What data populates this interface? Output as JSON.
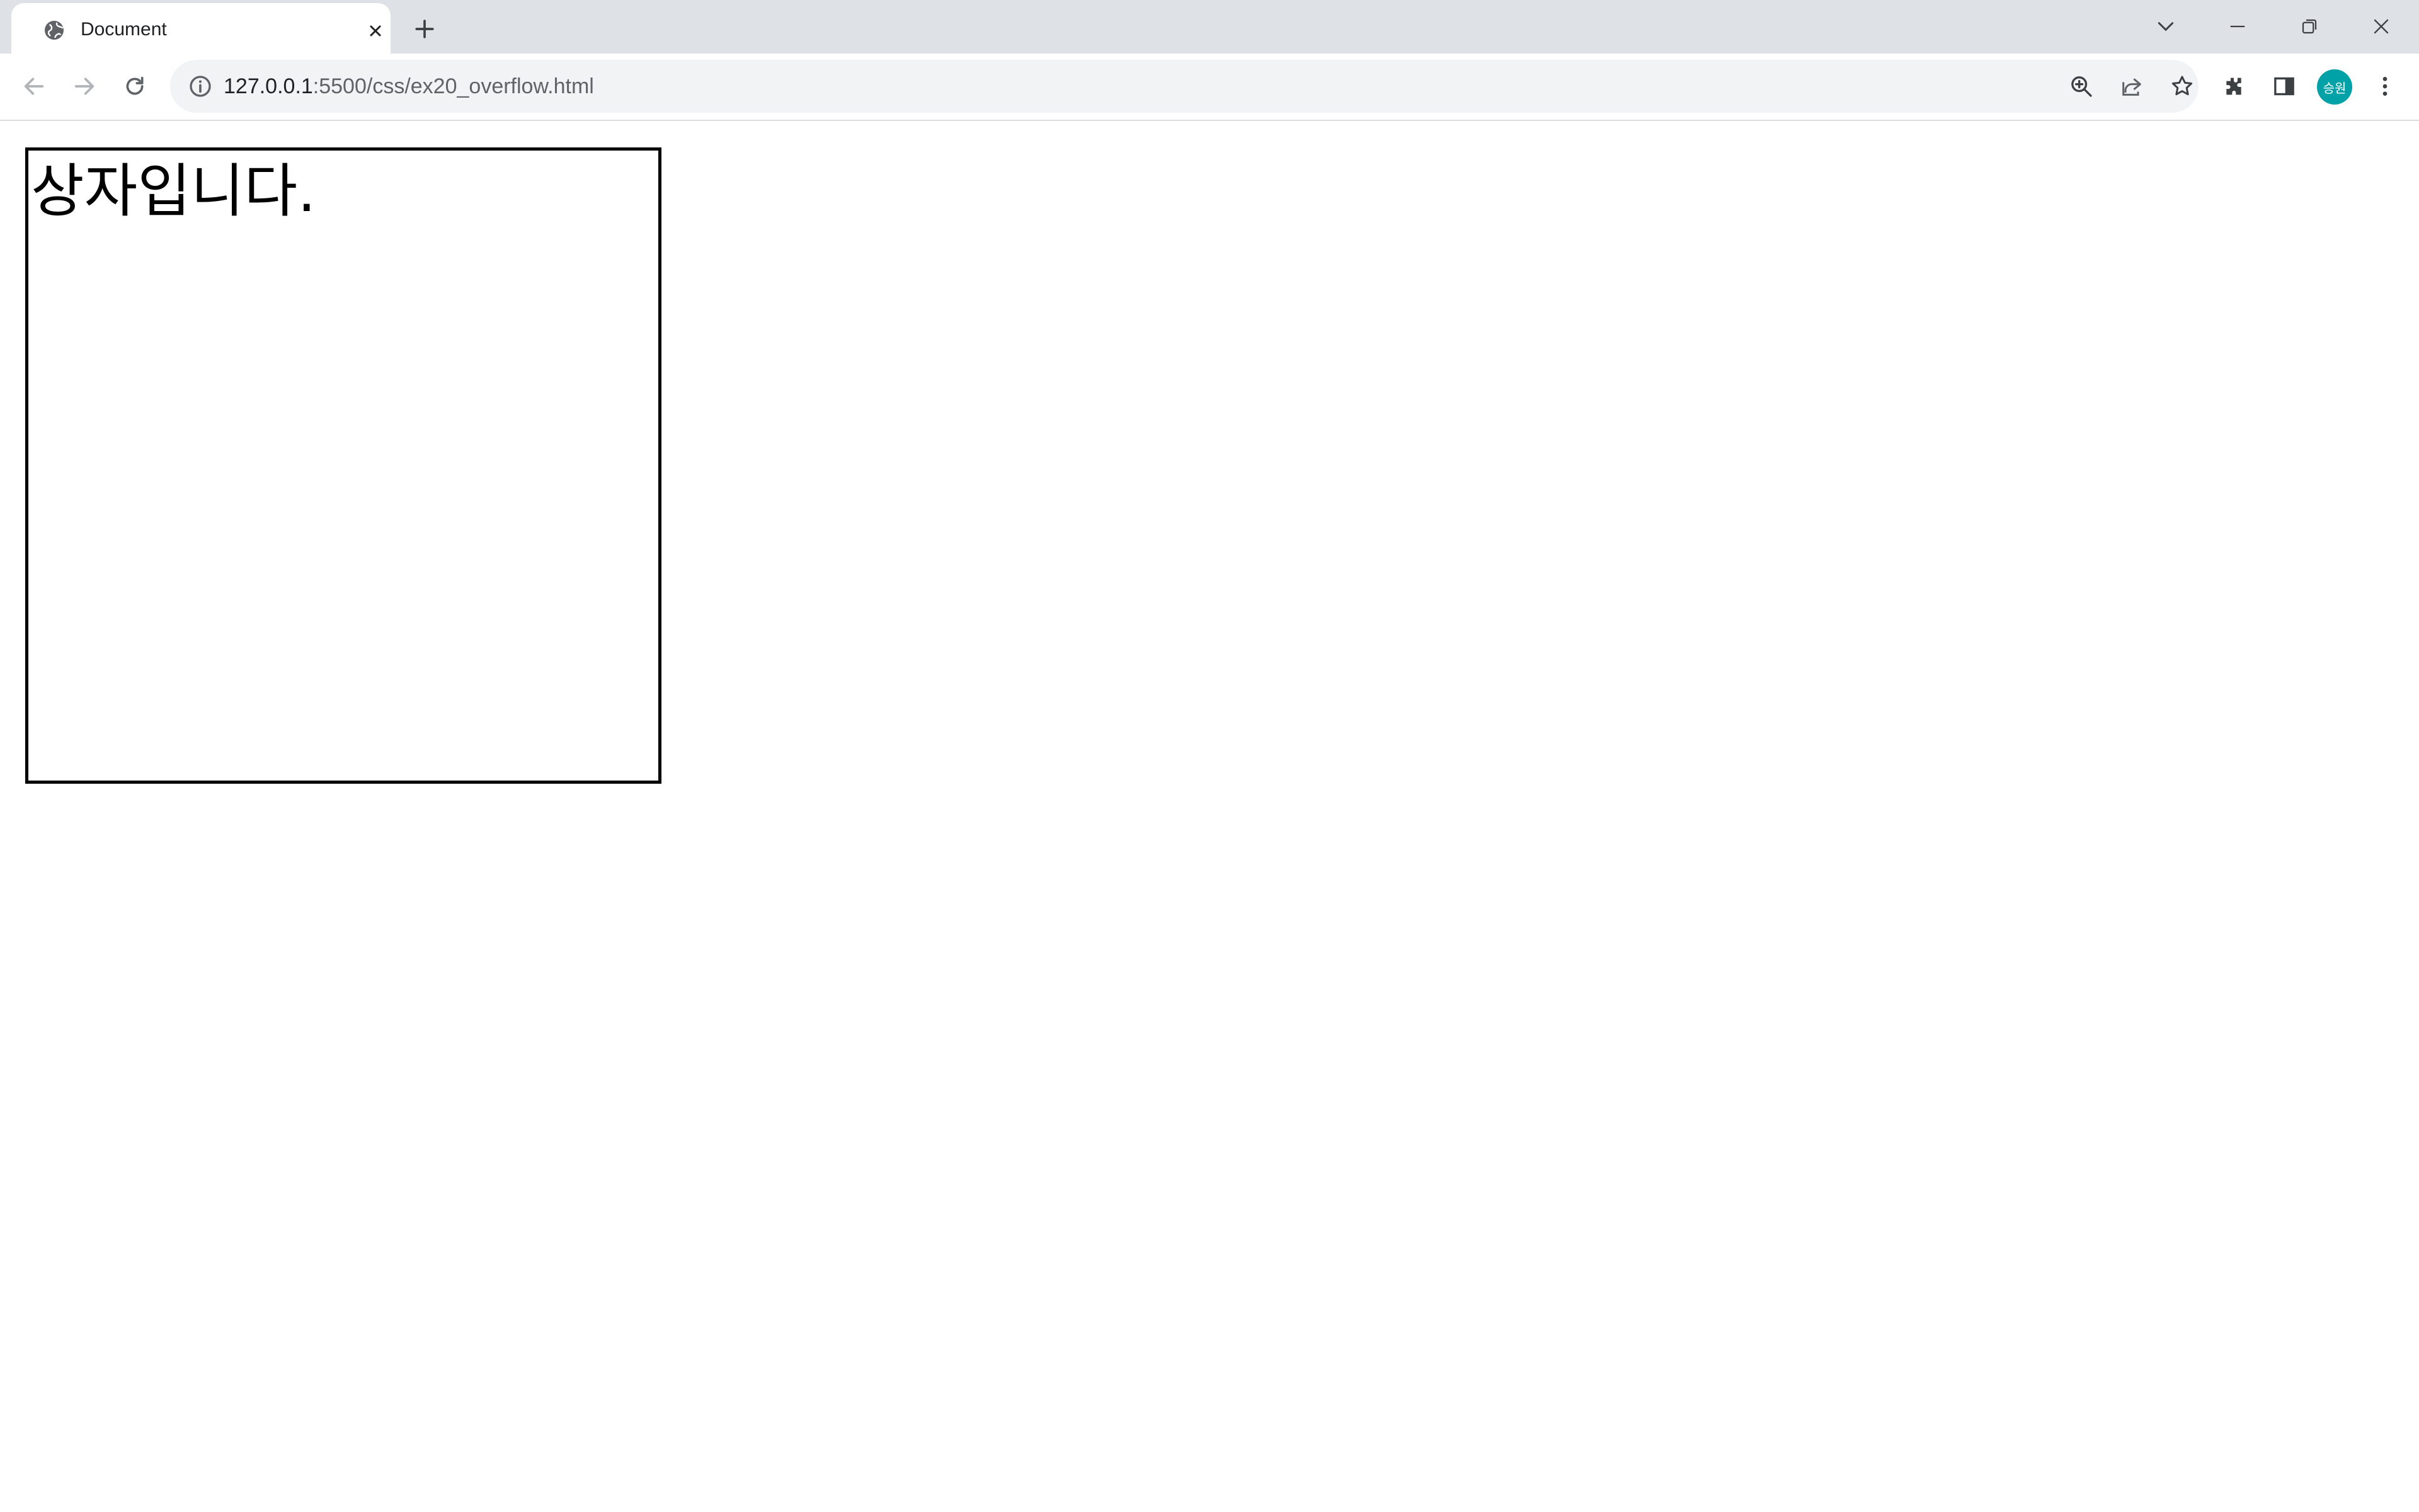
{
  "browser": {
    "tab": {
      "title": "Document",
      "favicon": "globe-icon"
    },
    "toolbar": {
      "url_host": "127.0.0.1",
      "url_rest": ":5500/css/ex20_overflow.html",
      "profile_initials": "승원"
    },
    "colors": {
      "tabstrip": "#dee1e6",
      "omnibox": "#f1f3f4",
      "avatar": "#00a2a8",
      "icon": "#5f6368"
    }
  },
  "page": {
    "box_text": "상자입니다."
  }
}
